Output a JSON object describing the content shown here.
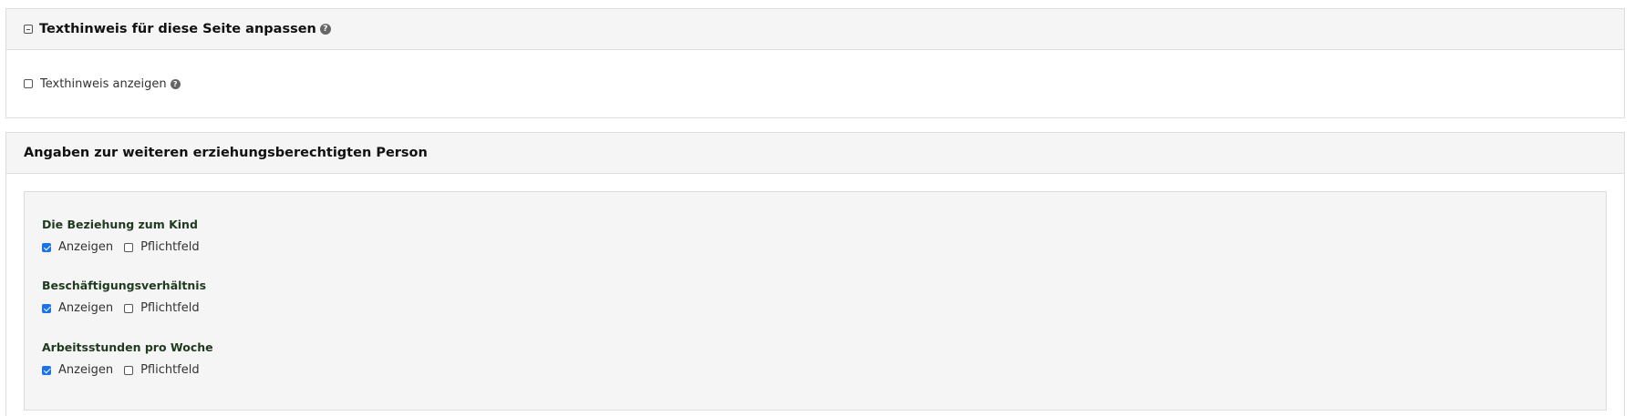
{
  "section_text_hint": {
    "title": "Texthinweis für diese Seite anpassen",
    "show_hint_label": "Texthinweis anzeigen",
    "show_hint_checked": false
  },
  "section_guardian": {
    "title": "Angaben zur weiteren erziehungsberechtigten Person",
    "fields": [
      {
        "title": "Die Beziehung zum Kind",
        "show_label": "Anzeigen",
        "show_checked": true,
        "required_label": "Pflichtfeld",
        "required_checked": false
      },
      {
        "title": "Beschäftigungsverhältnis",
        "show_label": "Anzeigen",
        "show_checked": true,
        "required_label": "Pflichtfeld",
        "required_checked": false
      },
      {
        "title": "Arbeitsstunden pro Woche",
        "show_label": "Anzeigen",
        "show_checked": true,
        "required_label": "Pflichtfeld",
        "required_checked": false
      }
    ]
  },
  "icons": {
    "collapse": "minus-square-icon",
    "help": "question-circle-icon"
  },
  "colors": {
    "checkbox_checked": "#1a73e8",
    "field_title": "#1f3a1f",
    "panel_heading_bg": "#f5f5f5"
  }
}
